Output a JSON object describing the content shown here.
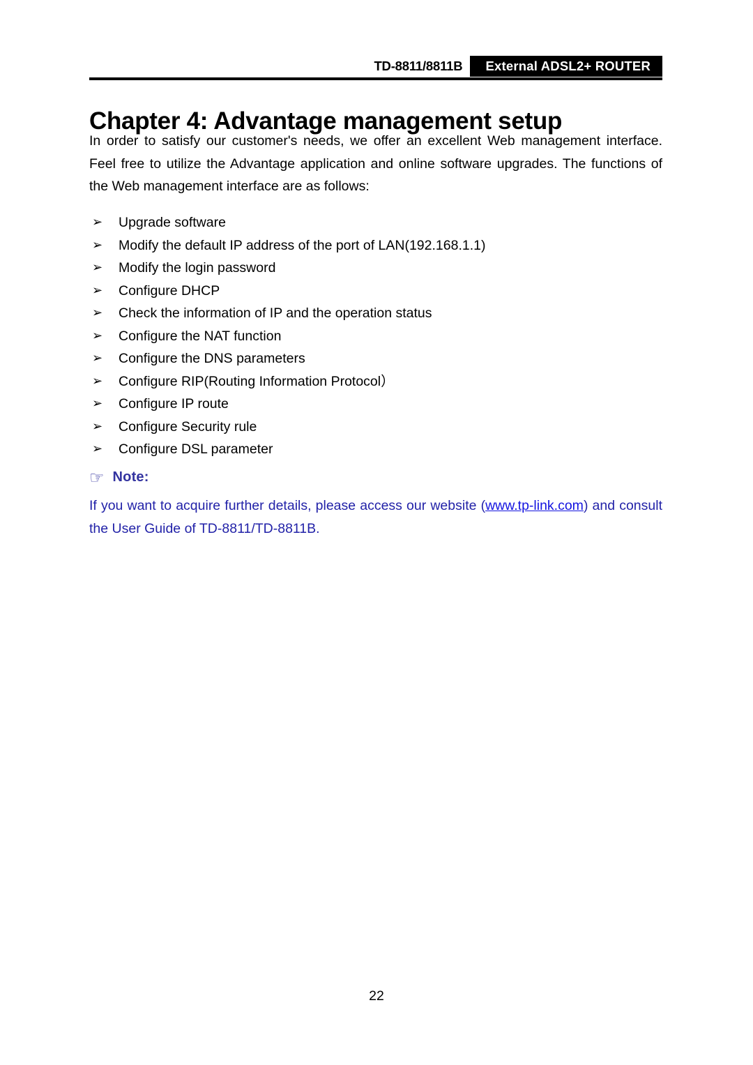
{
  "header": {
    "model": "TD-8811/8811B",
    "product": "External  ADSL2+  ROUTER"
  },
  "chapter": {
    "title": "Chapter 4: Advantage management setup"
  },
  "intro": {
    "paragraph": "In order to satisfy our customer's needs, we offer an excellent Web management interface. Feel free to utilize the Advantage application and online software upgrades. The functions of the Web management interface are as follows:"
  },
  "features": {
    "bullet_glyph": "➢",
    "items": [
      "Upgrade software",
      "Modify the default IP address of the port of LAN(192.168.1.1)",
      "Modify the login password",
      "Configure DHCP",
      "Check the information of IP and the operation status",
      "Configure the NAT function",
      "Configure the DNS parameters",
      "Configure RIP(Routing Information Protocol）",
      "Configure IP route",
      "Configure Security rule",
      "Configure DSL parameter"
    ]
  },
  "note": {
    "hand_glyph": "☞",
    "label": "Note:",
    "text_before": "If you want to acquire further details, please access our website (",
    "link": "www.tp-link.com",
    "text_after": ") and consult the User Guide of TD-8811/TD-8811B."
  },
  "footer": {
    "page_number": "22"
  },
  "colors": {
    "note_heading": "#3333A0",
    "note_body": "#2222A8",
    "note_link": "#1414E0",
    "header_box_bg": "#000000",
    "text": "#000000"
  }
}
